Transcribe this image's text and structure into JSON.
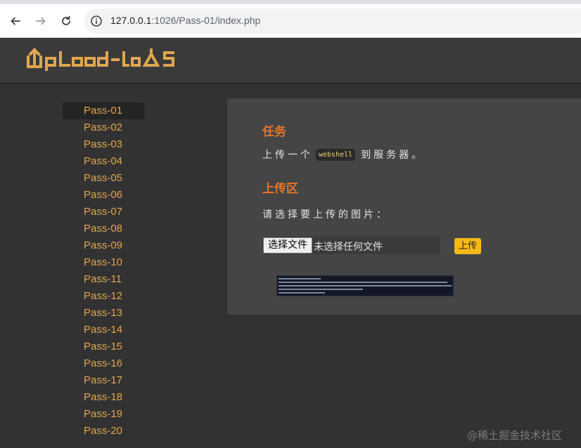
{
  "browser": {
    "url_host": "127.0.0.1",
    "url_rest": ":1026/Pass-01/index.php",
    "icons": [
      "back-arrow-icon",
      "forward-arrow-icon",
      "reload-icon",
      "site-info-icon"
    ]
  },
  "header": {
    "logo_text": "Upload-labs",
    "logo_color": "#e0a64e"
  },
  "sidebar": {
    "items": [
      {
        "label": "Pass-01"
      },
      {
        "label": "Pass-02"
      },
      {
        "label": "Pass-03"
      },
      {
        "label": "Pass-04"
      },
      {
        "label": "Pass-05"
      },
      {
        "label": "Pass-06"
      },
      {
        "label": "Pass-07"
      },
      {
        "label": "Pass-08"
      },
      {
        "label": "Pass-09"
      },
      {
        "label": "Pass-10"
      },
      {
        "label": "Pass-11"
      },
      {
        "label": "Pass-12"
      },
      {
        "label": "Pass-13"
      },
      {
        "label": "Pass-14"
      },
      {
        "label": "Pass-15"
      },
      {
        "label": "Pass-16"
      },
      {
        "label": "Pass-17"
      },
      {
        "label": "Pass-18"
      },
      {
        "label": "Pass-19"
      },
      {
        "label": "Pass-20"
      }
    ],
    "active_index": 0
  },
  "main": {
    "task_title": "任务",
    "task_prefix": "上传一个",
    "task_code": "webshell",
    "task_suffix": "到服务器。",
    "upload_title": "上传区",
    "choose_label": "请选择要上传的图片：",
    "file_button": "选择文件",
    "file_status": "未选择任何文件",
    "upload_button": "上传"
  },
  "colors": {
    "accent_orange": "#e8752a",
    "link_gold": "#e0a64e",
    "upload_button": "#f7b917"
  },
  "watermark": "@稀土掘金技术社区"
}
